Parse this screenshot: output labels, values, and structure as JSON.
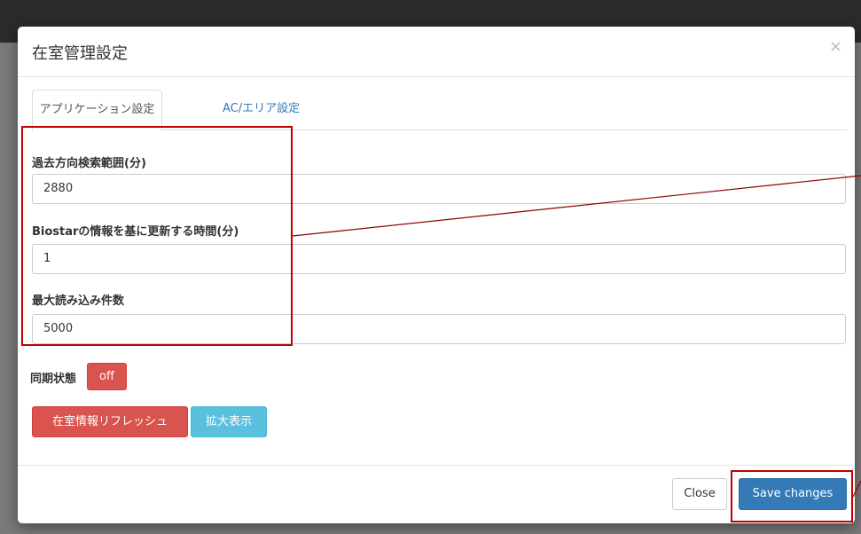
{
  "modal": {
    "title": "在室管理設定",
    "close_symbol": "×"
  },
  "tabs": [
    {
      "label": "アプリケーション設定",
      "active": true
    },
    {
      "label": "AC/エリア設定",
      "active": false
    }
  ],
  "form": {
    "search_range_label": "過去方向検索範囲(分)",
    "search_range_value": "2880",
    "update_interval_label": "Biostarの情報を基に更新する時間(分)",
    "update_interval_value": "1",
    "max_records_label": "最大読み込み件数",
    "max_records_value": "5000"
  },
  "sync": {
    "label": "同期状態",
    "button": "off"
  },
  "actions": {
    "refresh": "在室情報リフレッシュ",
    "zoom": "拡大表示"
  },
  "footer": {
    "close": "Close",
    "save": "Save changes"
  },
  "colors": {
    "primary": "#337ab7",
    "danger": "#d9534f",
    "info": "#5bc0de",
    "annotation": "#c00000"
  }
}
